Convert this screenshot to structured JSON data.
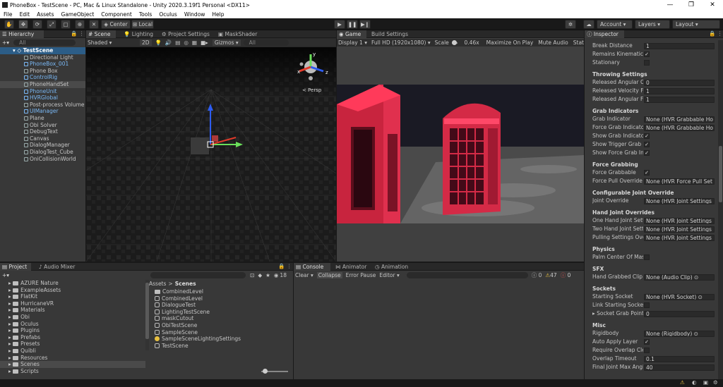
{
  "window": {
    "title": "PhoneBox - TestScene - PC, Mac & Linux Standalone - Unity 2020.3.19f1 Personal <DX11>",
    "min": "—",
    "max": "❐",
    "close": "✕"
  },
  "menu": [
    "File",
    "Edit",
    "Assets",
    "GameObject",
    "Component",
    "Tools",
    "Oculus",
    "Window",
    "Help"
  ],
  "toolbar": {
    "center": "Center",
    "local": "Local",
    "account": "Account",
    "layers": "Layers",
    "layout": "Layout"
  },
  "hierarchy": {
    "tab": "Hierarchy",
    "search_placeholder": "All",
    "scene": "TestScene",
    "items": [
      {
        "label": "Directional Light",
        "blue": false
      },
      {
        "label": "PhoneBox_001",
        "blue": true
      },
      {
        "label": "Phone Box",
        "blue": false
      },
      {
        "label": "ControlRig",
        "blue": true
      },
      {
        "label": "PhoneHandSet",
        "blue": false
      },
      {
        "label": "PhoneUnit",
        "blue": true
      },
      {
        "label": "HVRGlobal",
        "blue": true
      },
      {
        "label": "Post-process Volume",
        "blue": false
      },
      {
        "label": "UIManager",
        "blue": true
      },
      {
        "label": "Plane",
        "blue": false
      },
      {
        "label": "Obi Solver",
        "blue": false
      },
      {
        "label": "DebugText",
        "blue": false
      },
      {
        "label": "Canvas",
        "blue": false
      },
      {
        "label": "DialogManager",
        "blue": false
      },
      {
        "label": "DialogTest_Cube",
        "blue": false
      },
      {
        "label": "OniCollisionWorld",
        "blue": false
      }
    ]
  },
  "scene": {
    "tabs": [
      "Scene",
      "Lighting",
      "Project Settings",
      "MaskShader"
    ],
    "shading": "Shaded",
    "mode2d": "2D",
    "gizmos": "Gizmos",
    "search": "All",
    "persp": "< Persp",
    "axes": {
      "x": "x",
      "y": "y",
      "z": "z"
    }
  },
  "game": {
    "tabs": [
      "Game",
      "Build Settings"
    ],
    "display": "Display 1",
    "resolution": "Full HD (1920x1080)",
    "scale_label": "Scale",
    "scale": "0.46x",
    "maximize": "Maximize On Play",
    "mute": "Mute Audio",
    "stats": "Stat"
  },
  "inspector": {
    "tab": "Inspector",
    "rows": [
      {
        "type": "field",
        "label": "Break Distance",
        "value": "1"
      },
      {
        "type": "check",
        "label": "Remains Kinematic",
        "value": "✓"
      },
      {
        "type": "check",
        "label": "Stationary",
        "value": ""
      },
      {
        "type": "section",
        "label": "Throwing Settings"
      },
      {
        "type": "field",
        "label": "Released Angular Conversion",
        "value": "0"
      },
      {
        "type": "field",
        "label": "Released Velocity Factor",
        "value": "1"
      },
      {
        "type": "field",
        "label": "Released Angular Factor",
        "value": "1"
      },
      {
        "type": "section",
        "label": "Grab Indicators"
      },
      {
        "type": "field",
        "label": "Grab Indicator",
        "value": "None (HVR Grabbable Ho ⊙"
      },
      {
        "type": "field",
        "label": "Force Grab Indicator",
        "value": "None (HVR Grabbable Ho ⊙"
      },
      {
        "type": "check",
        "label": "Show Grab Indicator",
        "value": "✓"
      },
      {
        "type": "check",
        "label": "Show Trigger Grab Indicator",
        "value": "✓"
      },
      {
        "type": "check",
        "label": "Show Force Grab Indicator",
        "value": "✓"
      },
      {
        "type": "section",
        "label": "Force Grabbing"
      },
      {
        "type": "check",
        "label": "Force Grabbable",
        "value": "✓"
      },
      {
        "type": "field",
        "label": "Force Pull Override",
        "value": "None (HVR Force Pull Set ⊙"
      },
      {
        "type": "section",
        "label": "Configurable Joint Override"
      },
      {
        "type": "field",
        "label": "Joint Override",
        "value": "None (HVR Joint Settings ⊙"
      },
      {
        "type": "section",
        "label": "Hand Joint Overrides"
      },
      {
        "type": "field",
        "label": "One Hand Joint Settings",
        "value": "None (HVR Joint Settings ⊙"
      },
      {
        "type": "field",
        "label": "Two Hand Joint Settings",
        "value": "None (HVR Joint Settings ⊙"
      },
      {
        "type": "field",
        "label": "Pulling Settings Override",
        "value": "None (HVR Joint Settings ⊙"
      },
      {
        "type": "section",
        "label": "Physics"
      },
      {
        "type": "check",
        "label": "Palm Center Of Mass",
        "value": ""
      },
      {
        "type": "section",
        "label": "SFX"
      },
      {
        "type": "field",
        "label": "Hand Grabbed Clip",
        "value": "None (Audio Clip) ⊙"
      },
      {
        "type": "section",
        "label": "Sockets"
      },
      {
        "type": "field",
        "label": "Starting Socket",
        "value": "None (HVR Socket) ⊙"
      },
      {
        "type": "check",
        "label": "Link Starting Socket",
        "value": ""
      },
      {
        "type": "field",
        "label": "▸ Socket Grab Points",
        "value": "0"
      },
      {
        "type": "section",
        "label": "Misc"
      },
      {
        "type": "field",
        "label": "Rigidbody",
        "value": "None (Rigidbody) ⊙"
      },
      {
        "type": "check",
        "label": "Auto Apply Layer",
        "value": "✓"
      },
      {
        "type": "check",
        "label": "Require Overlap Clearance",
        "value": ""
      },
      {
        "type": "field",
        "label": "Overlap Timeout",
        "value": "0.1"
      },
      {
        "type": "field",
        "label": "Final Joint Max Angle",
        "value": "40"
      }
    ]
  },
  "project": {
    "tabs": [
      "Project",
      "Audio Mixer"
    ],
    "count": "18",
    "folders": [
      "AZURE Nature",
      "ExampleAssets",
      "FlatKit",
      "HurricaneVR",
      "Materials",
      "Obi",
      "Oculus",
      "Plugins",
      "Prefabs",
      "Presets",
      "Quibli",
      "Resources",
      "Scenes",
      "Scripts"
    ],
    "breadcrumb": [
      "Assets",
      ">",
      "Scenes"
    ],
    "files": [
      {
        "label": "CombinedLevel",
        "kind": "folder"
      },
      {
        "label": "CombinedLevel",
        "kind": "scene"
      },
      {
        "label": "DialogueTest",
        "kind": "scene"
      },
      {
        "label": "LightingTestScene",
        "kind": "scene"
      },
      {
        "label": "maskCutout",
        "kind": "scene"
      },
      {
        "label": "ObiTestScene",
        "kind": "scene"
      },
      {
        "label": "SampleScene",
        "kind": "scene"
      },
      {
        "label": "SampleSceneLightingSettings",
        "kind": "light"
      },
      {
        "label": "TestScene",
        "kind": "scene"
      }
    ]
  },
  "console": {
    "tabs": [
      "Console",
      "Animator",
      "Animation"
    ],
    "clear": "Clear",
    "collapse": "Collapse",
    "error_pause": "Error Pause",
    "editor": "Editor",
    "errors": "0",
    "warnings": "47",
    "messages": "0"
  }
}
